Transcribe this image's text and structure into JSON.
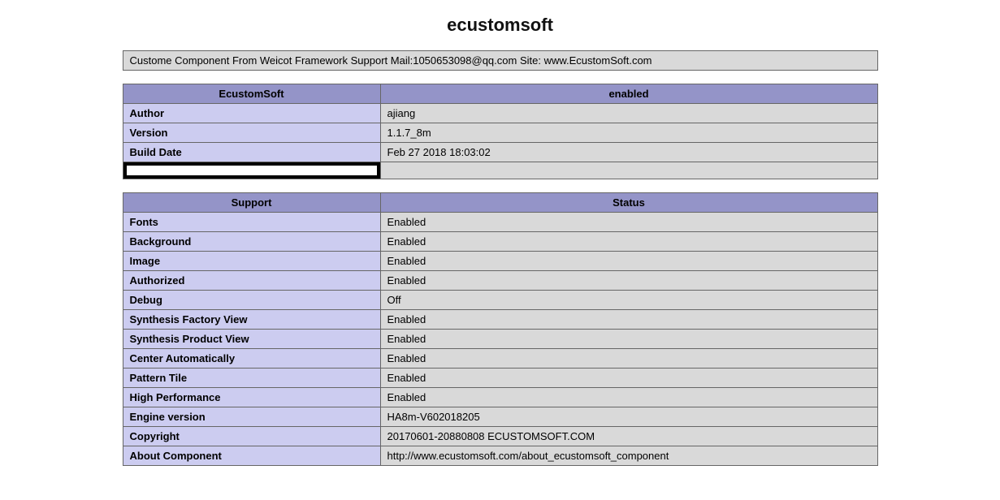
{
  "page": {
    "title": "ecustomsoft",
    "intro": "Custome Component From Weicot Framework Support Mail:1050653098@qq.com Site: www.EcustomSoft.com"
  },
  "table_top": {
    "header_left": "EcustomSoft",
    "header_right": "enabled",
    "rows": [
      {
        "key": "Author",
        "val": "ajiang"
      },
      {
        "key": "Version",
        "val": "1.1.7_8m"
      },
      {
        "key": "Build Date",
        "val": "Feb 27 2018 18:03:02"
      }
    ]
  },
  "table_support": {
    "header_left": "Support",
    "header_right": "Status",
    "rows": [
      {
        "key": "Fonts",
        "val": "Enabled"
      },
      {
        "key": "Background",
        "val": "Enabled"
      },
      {
        "key": "Image",
        "val": "Enabled"
      },
      {
        "key": "Authorized",
        "val": "Enabled"
      },
      {
        "key": "Debug",
        "val": "Off"
      },
      {
        "key": "Synthesis Factory View",
        "val": "Enabled"
      },
      {
        "key": "Synthesis Product View",
        "val": "Enabled"
      },
      {
        "key": "Center Automatically",
        "val": "Enabled"
      },
      {
        "key": "Pattern Tile",
        "val": "Enabled"
      },
      {
        "key": "High Performance",
        "val": "Enabled"
      },
      {
        "key": "Engine version",
        "val": "HA8m-V602018205"
      },
      {
        "key": "Copyright",
        "val": "20170601-20880808 ECUSTOMSOFT.COM"
      },
      {
        "key": "About Component",
        "val": "http://www.ecustomsoft.com/about_ecustomsoft_component"
      }
    ]
  }
}
